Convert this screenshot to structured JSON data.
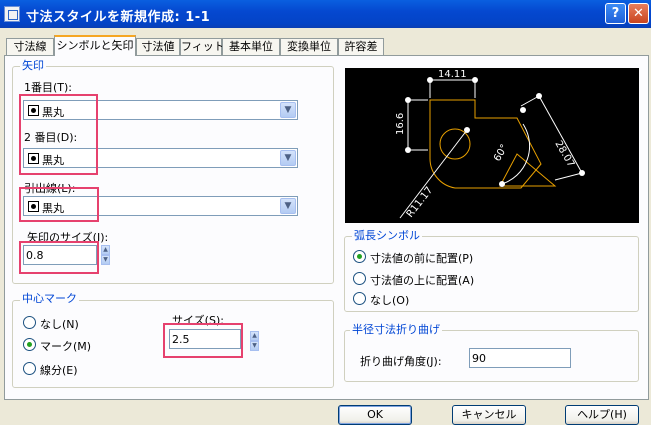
{
  "window": {
    "title": "寸法スタイルを新規作成: 1-1",
    "help_glyph": "?",
    "close_glyph": "✕"
  },
  "tabs": [
    {
      "label": "寸法線"
    },
    {
      "label": "シンボルと矢印"
    },
    {
      "label": "寸法値"
    },
    {
      "label": "フィット"
    },
    {
      "label": "基本単位"
    },
    {
      "label": "変換単位"
    },
    {
      "label": "許容差"
    }
  ],
  "arrowheads": {
    "group_label": "矢印",
    "first_label": "1番目(T):",
    "first_value": "黒丸",
    "second_label": "2 番目(D):",
    "second_value": "黒丸",
    "leader_label": "引出線(L):",
    "leader_value": "黒丸",
    "size_label": "矢印のサイズ(I):",
    "size_value": "0.8"
  },
  "center_mark": {
    "group_label": "中心マーク",
    "options": [
      "なし(N)",
      "マーク(M)",
      "線分(E)"
    ],
    "selected": "マーク(M)",
    "size_label": "サイズ(S):",
    "size_value": "2.5"
  },
  "arc_symbol": {
    "group_label": "弧長シンボル",
    "options": [
      "寸法値の前に配置(P)",
      "寸法値の上に配置(A)",
      "なし(O)"
    ],
    "selected": "寸法値の前に配置(P)"
  },
  "radius_jog": {
    "group_label": "半径寸法折り曲げ",
    "angle_label": "折り曲げ角度(J):",
    "angle_value": "90"
  },
  "preview": {
    "labels": {
      "top": "14.11",
      "left": "16.6",
      "right": "28.07",
      "angle": "60°",
      "radius": "R11.17"
    },
    "colors": {
      "geometry": "#e8a000",
      "dimension": "#ffffff",
      "background": "#000000"
    }
  },
  "buttons": {
    "ok": "OK",
    "cancel": "キャンセル",
    "help": "ヘルプ(H)"
  },
  "colors": {
    "highlight": "#e6416e",
    "group_label": "#0046d5",
    "title_bar": "#0548d0"
  }
}
